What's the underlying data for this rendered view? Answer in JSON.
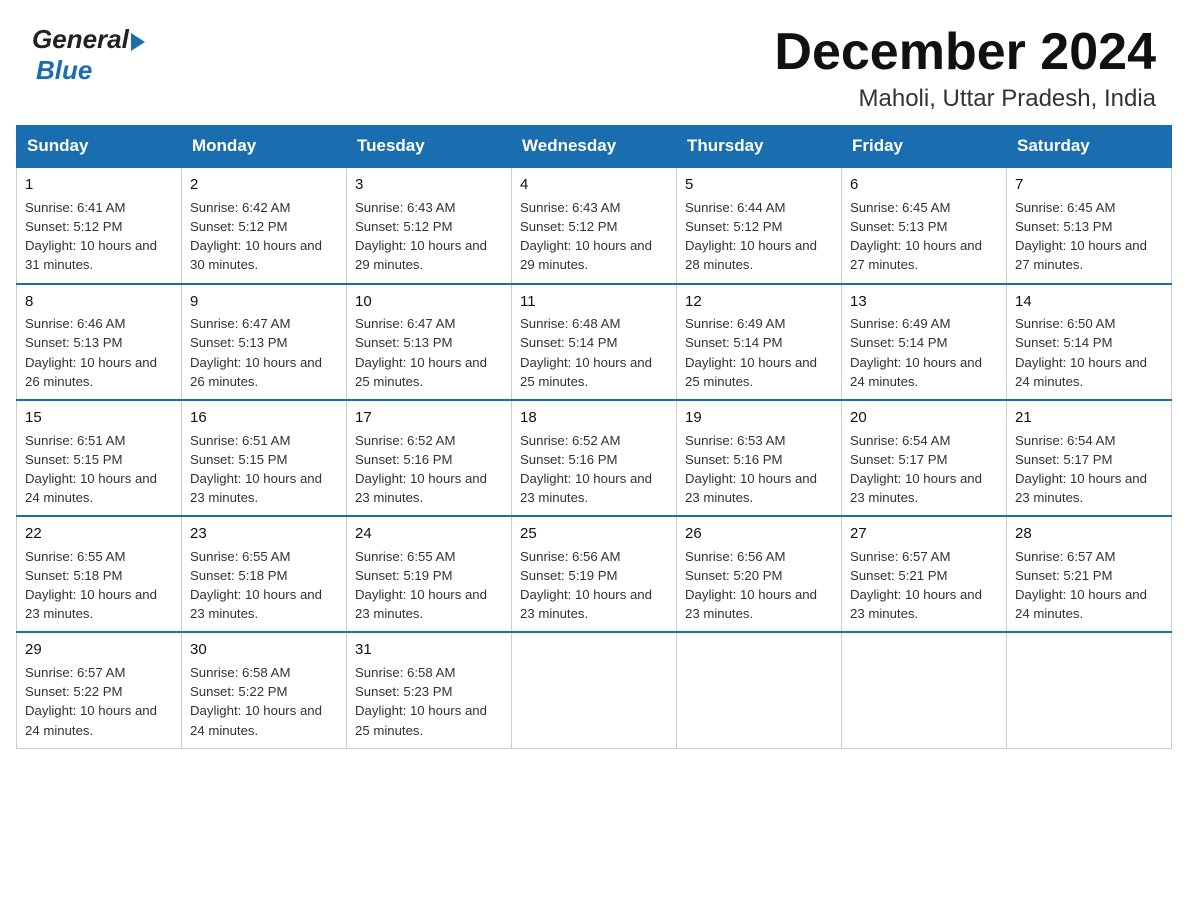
{
  "logo": {
    "general": "General",
    "blue": "Blue"
  },
  "header": {
    "month": "December 2024",
    "location": "Maholi, Uttar Pradesh, India"
  },
  "weekdays": [
    "Sunday",
    "Monday",
    "Tuesday",
    "Wednesday",
    "Thursday",
    "Friday",
    "Saturday"
  ],
  "weeks": [
    [
      {
        "day": "1",
        "sunrise": "6:41 AM",
        "sunset": "5:12 PM",
        "daylight": "10 hours and 31 minutes."
      },
      {
        "day": "2",
        "sunrise": "6:42 AM",
        "sunset": "5:12 PM",
        "daylight": "10 hours and 30 minutes."
      },
      {
        "day": "3",
        "sunrise": "6:43 AM",
        "sunset": "5:12 PM",
        "daylight": "10 hours and 29 minutes."
      },
      {
        "day": "4",
        "sunrise": "6:43 AM",
        "sunset": "5:12 PM",
        "daylight": "10 hours and 29 minutes."
      },
      {
        "day": "5",
        "sunrise": "6:44 AM",
        "sunset": "5:12 PM",
        "daylight": "10 hours and 28 minutes."
      },
      {
        "day": "6",
        "sunrise": "6:45 AM",
        "sunset": "5:13 PM",
        "daylight": "10 hours and 27 minutes."
      },
      {
        "day": "7",
        "sunrise": "6:45 AM",
        "sunset": "5:13 PM",
        "daylight": "10 hours and 27 minutes."
      }
    ],
    [
      {
        "day": "8",
        "sunrise": "6:46 AM",
        "sunset": "5:13 PM",
        "daylight": "10 hours and 26 minutes."
      },
      {
        "day": "9",
        "sunrise": "6:47 AM",
        "sunset": "5:13 PM",
        "daylight": "10 hours and 26 minutes."
      },
      {
        "day": "10",
        "sunrise": "6:47 AM",
        "sunset": "5:13 PM",
        "daylight": "10 hours and 25 minutes."
      },
      {
        "day": "11",
        "sunrise": "6:48 AM",
        "sunset": "5:14 PM",
        "daylight": "10 hours and 25 minutes."
      },
      {
        "day": "12",
        "sunrise": "6:49 AM",
        "sunset": "5:14 PM",
        "daylight": "10 hours and 25 minutes."
      },
      {
        "day": "13",
        "sunrise": "6:49 AM",
        "sunset": "5:14 PM",
        "daylight": "10 hours and 24 minutes."
      },
      {
        "day": "14",
        "sunrise": "6:50 AM",
        "sunset": "5:14 PM",
        "daylight": "10 hours and 24 minutes."
      }
    ],
    [
      {
        "day": "15",
        "sunrise": "6:51 AM",
        "sunset": "5:15 PM",
        "daylight": "10 hours and 24 minutes."
      },
      {
        "day": "16",
        "sunrise": "6:51 AM",
        "sunset": "5:15 PM",
        "daylight": "10 hours and 23 minutes."
      },
      {
        "day": "17",
        "sunrise": "6:52 AM",
        "sunset": "5:16 PM",
        "daylight": "10 hours and 23 minutes."
      },
      {
        "day": "18",
        "sunrise": "6:52 AM",
        "sunset": "5:16 PM",
        "daylight": "10 hours and 23 minutes."
      },
      {
        "day": "19",
        "sunrise": "6:53 AM",
        "sunset": "5:16 PM",
        "daylight": "10 hours and 23 minutes."
      },
      {
        "day": "20",
        "sunrise": "6:54 AM",
        "sunset": "5:17 PM",
        "daylight": "10 hours and 23 minutes."
      },
      {
        "day": "21",
        "sunrise": "6:54 AM",
        "sunset": "5:17 PM",
        "daylight": "10 hours and 23 minutes."
      }
    ],
    [
      {
        "day": "22",
        "sunrise": "6:55 AM",
        "sunset": "5:18 PM",
        "daylight": "10 hours and 23 minutes."
      },
      {
        "day": "23",
        "sunrise": "6:55 AM",
        "sunset": "5:18 PM",
        "daylight": "10 hours and 23 minutes."
      },
      {
        "day": "24",
        "sunrise": "6:55 AM",
        "sunset": "5:19 PM",
        "daylight": "10 hours and 23 minutes."
      },
      {
        "day": "25",
        "sunrise": "6:56 AM",
        "sunset": "5:19 PM",
        "daylight": "10 hours and 23 minutes."
      },
      {
        "day": "26",
        "sunrise": "6:56 AM",
        "sunset": "5:20 PM",
        "daylight": "10 hours and 23 minutes."
      },
      {
        "day": "27",
        "sunrise": "6:57 AM",
        "sunset": "5:21 PM",
        "daylight": "10 hours and 23 minutes."
      },
      {
        "day": "28",
        "sunrise": "6:57 AM",
        "sunset": "5:21 PM",
        "daylight": "10 hours and 24 minutes."
      }
    ],
    [
      {
        "day": "29",
        "sunrise": "6:57 AM",
        "sunset": "5:22 PM",
        "daylight": "10 hours and 24 minutes."
      },
      {
        "day": "30",
        "sunrise": "6:58 AM",
        "sunset": "5:22 PM",
        "daylight": "10 hours and 24 minutes."
      },
      {
        "day": "31",
        "sunrise": "6:58 AM",
        "sunset": "5:23 PM",
        "daylight": "10 hours and 25 minutes."
      },
      null,
      null,
      null,
      null
    ]
  ]
}
